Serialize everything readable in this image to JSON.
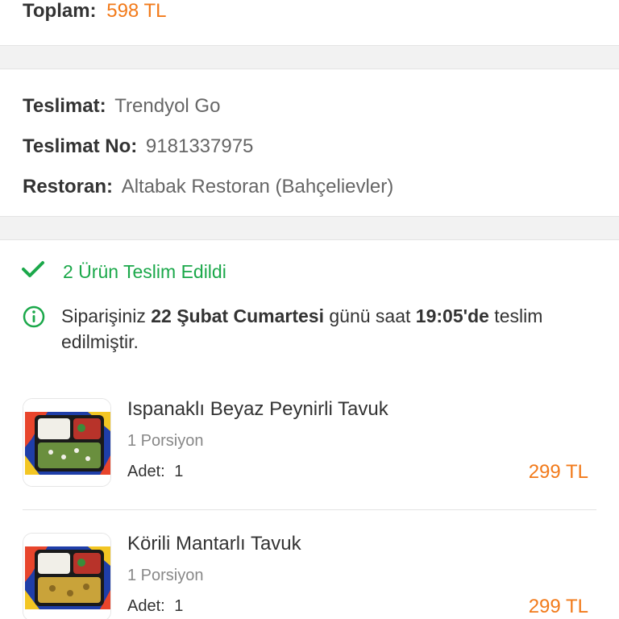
{
  "total": {
    "label": "Toplam:",
    "value": "598 TL"
  },
  "delivery": {
    "carrier_label": "Teslimat:",
    "carrier_value": "Trendyol Go",
    "number_label": "Teslimat No:",
    "number_value": "9181337975",
    "restaurant_label": "Restoran:",
    "restaurant_value": "Altabak Restoran (Bahçelievler)"
  },
  "status": {
    "text": "2 Ürün Teslim Edildi",
    "icon": "check-icon",
    "color": "#1ba84a"
  },
  "note": {
    "icon": "info-circle-icon",
    "prefix": "Siparişiniz ",
    "date": "22 Şubat Cumartesi",
    "middle": " günü saat ",
    "time": "19:05'de",
    "suffix": " teslim edilmiştir."
  },
  "products": [
    {
      "name": "Ispanaklı Beyaz Peynirli Tavuk",
      "portion": "1 Porsiyon",
      "qty_label": "Adet:",
      "qty": "1",
      "price": "299 TL"
    },
    {
      "name": "Körili Mantarlı Tavuk",
      "portion": "1 Porsiyon",
      "qty_label": "Adet:",
      "qty": "1",
      "price": "299 TL"
    }
  ],
  "colors": {
    "accent": "#f27a1a",
    "success": "#1ba84a"
  }
}
